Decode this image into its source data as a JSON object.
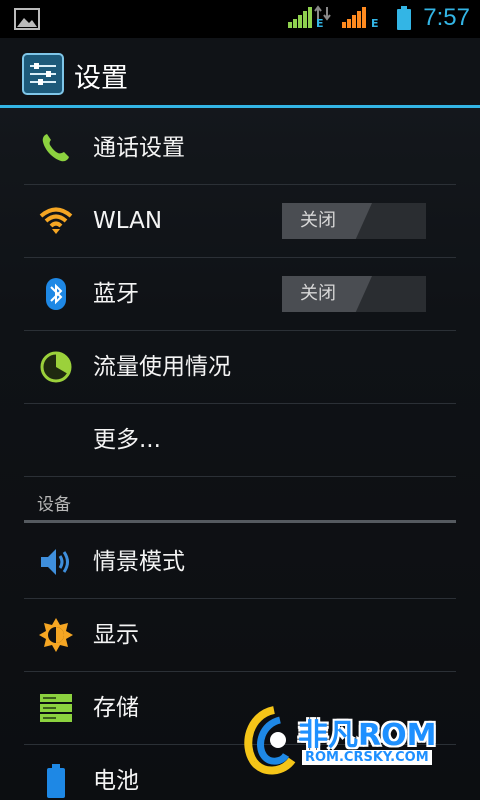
{
  "status_bar": {
    "time": "7:57",
    "network1": "E",
    "network2": "E",
    "icons": [
      "gallery-icon",
      "signal-green-icon",
      "data-arrows-icon",
      "signal-orange-icon",
      "battery-icon"
    ]
  },
  "action_bar": {
    "title": "设置",
    "icon": "settings-sliders-icon"
  },
  "list": [
    {
      "label": "通话设置",
      "icon": "phone-icon"
    },
    {
      "label": "WLAN",
      "icon": "wifi-icon",
      "toggle": "关闭"
    },
    {
      "label": "蓝牙",
      "icon": "bluetooth-icon",
      "toggle": "关闭"
    },
    {
      "label": "流量使用情况",
      "icon": "data-usage-icon"
    },
    {
      "label": "更多..."
    }
  ],
  "section": {
    "title": "设备"
  },
  "device_list": [
    {
      "label": "情景模式",
      "icon": "volume-icon"
    },
    {
      "label": "显示",
      "icon": "brightness-icon"
    },
    {
      "label": "存储",
      "icon": "storage-icon"
    },
    {
      "label": "电池",
      "icon": "battery-icon"
    }
  ],
  "watermark": {
    "brand": "非凡ROM",
    "url": "ROM.CRSKY.COM"
  },
  "colors": {
    "accent": "#33b5e5",
    "background": "#0f1216",
    "divider": "#2b3036"
  }
}
